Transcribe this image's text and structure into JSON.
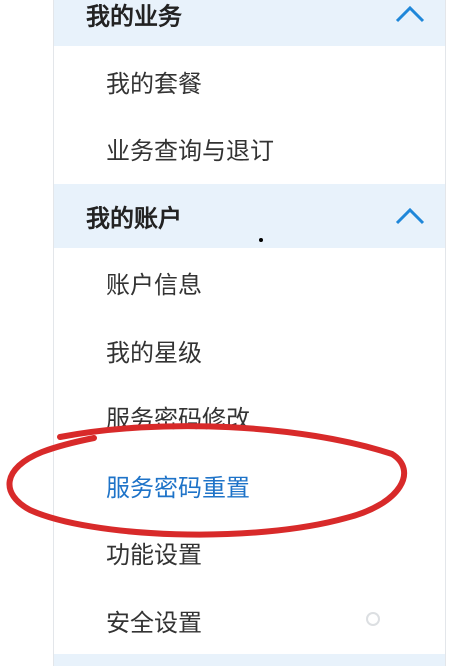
{
  "sections": [
    {
      "title": "我的业务",
      "expanded_icon": "chevron-up-icon",
      "items": [
        "我的套餐",
        "业务查询与退订"
      ]
    },
    {
      "title": "我的账户",
      "expanded_icon": "chevron-up-icon",
      "items": [
        "账户信息",
        "我的星级",
        "服务密码修改",
        "服务密码重置",
        "功能设置",
        "安全设置"
      ]
    }
  ],
  "active_item": "服务密码重置",
  "colors": {
    "header_bg": "#e8f2fb",
    "active_text": "#1e73c8",
    "chevron": "#1f87d9",
    "annotation": "#d82a2a"
  },
  "annotation_icon": "red-ellipse-highlight"
}
